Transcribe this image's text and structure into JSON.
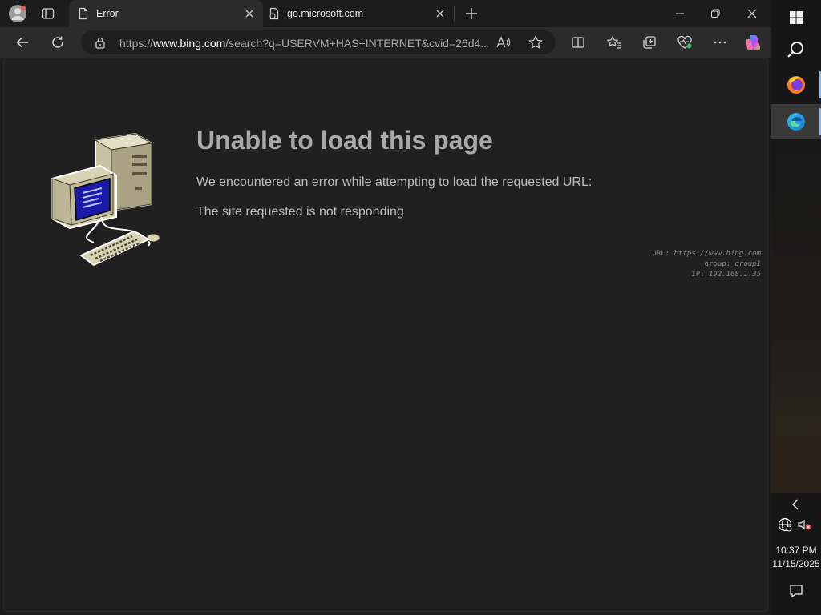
{
  "browser": {
    "tabs": [
      {
        "title": "Error",
        "favicon": "page-icon",
        "active": true
      },
      {
        "title": "go.microsoft.com",
        "favicon": "loading-page-icon",
        "active": false
      }
    ],
    "address": {
      "url_prefix": "https://",
      "url_host": "www.bing.com",
      "url_rest": "/search?q=USERVM+HAS+INTERNET&cvid=26d4..."
    }
  },
  "page": {
    "title": "Unable to load this page",
    "message1": "We encountered an error while attempting to load the requested URL:",
    "message2": "The site requested is not responding",
    "meta": {
      "url_label": "URL:",
      "url_value": "https://www.bing.com",
      "group_label": "group:",
      "group_value": "group1",
      "ip_label": "IP:",
      "ip_value": "192.168.1.35"
    }
  },
  "taskbar": {
    "time": "10:37 PM",
    "date": "11/15/2025"
  },
  "colors": {
    "accent": "#8fb8e8",
    "screen_blue": "#1a1aa8"
  }
}
